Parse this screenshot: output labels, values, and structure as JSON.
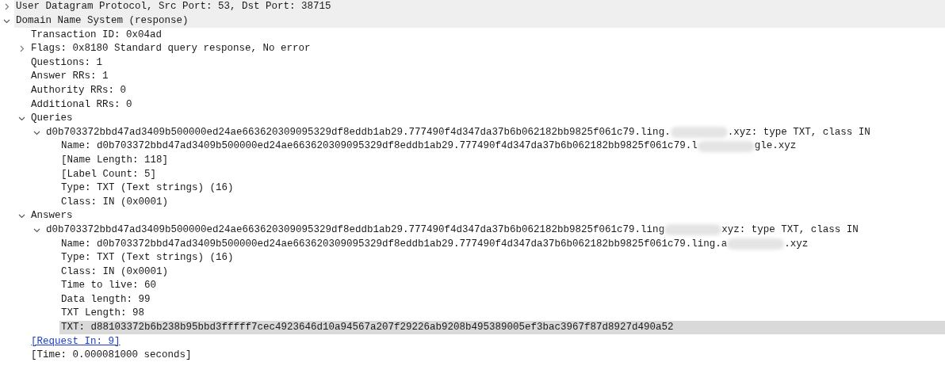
{
  "tree": [
    {
      "segments": [
        {
          "kind": "text",
          "text": "User Datagram Protocol, Src Port: 53, Dst Port: 38715"
        }
      ],
      "expanded": false,
      "highlighted": true,
      "selected": false
    },
    {
      "segments": [
        {
          "kind": "text",
          "text": "Domain Name System (response)"
        }
      ],
      "expanded": true,
      "highlighted": true,
      "selected": false,
      "children": [
        {
          "segments": [
            {
              "kind": "text",
              "text": "Transaction ID: 0x04ad"
            }
          ],
          "highlighted": false,
          "selected": false
        },
        {
          "segments": [
            {
              "kind": "text",
              "text": "Flags: 0x8180 Standard query response, No error"
            }
          ],
          "expanded": false,
          "highlighted": false,
          "selected": false
        },
        {
          "segments": [
            {
              "kind": "text",
              "text": "Questions: 1"
            }
          ],
          "highlighted": false,
          "selected": false
        },
        {
          "segments": [
            {
              "kind": "text",
              "text": "Answer RRs: 1"
            }
          ],
          "highlighted": false,
          "selected": false
        },
        {
          "segments": [
            {
              "kind": "text",
              "text": "Authority RRs: 0"
            }
          ],
          "highlighted": false,
          "selected": false
        },
        {
          "segments": [
            {
              "kind": "text",
              "text": "Additional RRs: 0"
            }
          ],
          "highlighted": false,
          "selected": false
        },
        {
          "segments": [
            {
              "kind": "text",
              "text": "Queries"
            }
          ],
          "expanded": true,
          "highlighted": false,
          "selected": false,
          "children": [
            {
              "segments": [
                {
                  "kind": "text",
                  "text": "d0b703372bbd47ad3409b500000ed24ae663620309095329df8eddb1ab29.777490f4d347da37b6b062182bb9825f061c79.ling."
                },
                {
                  "kind": "redaction"
                },
                {
                  "kind": "text",
                  "text": ".xyz: type TXT, class IN"
                }
              ],
              "expanded": true,
              "highlighted": false,
              "selected": false,
              "children": [
                {
                  "segments": [
                    {
                      "kind": "text",
                      "text": "Name: d0b703372bbd47ad3409b500000ed24ae663620309095329df8eddb1ab29.777490f4d347da37b6b062182bb9825f061c79.l"
                    },
                    {
                      "kind": "redaction"
                    },
                    {
                      "kind": "text",
                      "text": "gle.xyz"
                    }
                  ],
                  "highlighted": false,
                  "selected": false
                },
                {
                  "segments": [
                    {
                      "kind": "text",
                      "text": "[Name Length: 118]"
                    }
                  ],
                  "highlighted": false,
                  "selected": false
                },
                {
                  "segments": [
                    {
                      "kind": "text",
                      "text": "[Label Count: 5]"
                    }
                  ],
                  "highlighted": false,
                  "selected": false
                },
                {
                  "segments": [
                    {
                      "kind": "text",
                      "text": "Type: TXT (Text strings) (16)"
                    }
                  ],
                  "highlighted": false,
                  "selected": false
                },
                {
                  "segments": [
                    {
                      "kind": "text",
                      "text": "Class: IN (0x0001)"
                    }
                  ],
                  "highlighted": false,
                  "selected": false
                }
              ]
            }
          ]
        },
        {
          "segments": [
            {
              "kind": "text",
              "text": "Answers"
            }
          ],
          "expanded": true,
          "highlighted": false,
          "selected": false,
          "children": [
            {
              "segments": [
                {
                  "kind": "text",
                  "text": "d0b703372bbd47ad3409b500000ed24ae663620309095329df8eddb1ab29.777490f4d347da37b6b062182bb9825f061c79.ling"
                },
                {
                  "kind": "redaction"
                },
                {
                  "kind": "text",
                  "text": "xyz: type TXT, class IN"
                }
              ],
              "expanded": true,
              "highlighted": false,
              "selected": false,
              "children": [
                {
                  "segments": [
                    {
                      "kind": "text",
                      "text": "Name: d0b703372bbd47ad3409b500000ed24ae663620309095329df8eddb1ab29.777490f4d347da37b6b062182bb9825f061c79.ling.a"
                    },
                    {
                      "kind": "redaction"
                    },
                    {
                      "kind": "text",
                      "text": ".xyz"
                    }
                  ],
                  "highlighted": false,
                  "selected": false
                },
                {
                  "segments": [
                    {
                      "kind": "text",
                      "text": "Type: TXT (Text strings) (16)"
                    }
                  ],
                  "highlighted": false,
                  "selected": false
                },
                {
                  "segments": [
                    {
                      "kind": "text",
                      "text": "Class: IN (0x0001)"
                    }
                  ],
                  "highlighted": false,
                  "selected": false
                },
                {
                  "segments": [
                    {
                      "kind": "text",
                      "text": "Time to live: 60"
                    }
                  ],
                  "highlighted": false,
                  "selected": false
                },
                {
                  "segments": [
                    {
                      "kind": "text",
                      "text": "Data length: 99"
                    }
                  ],
                  "highlighted": false,
                  "selected": false
                },
                {
                  "segments": [
                    {
                      "kind": "text",
                      "text": "TXT Length: 98"
                    }
                  ],
                  "highlighted": false,
                  "selected": false
                },
                {
                  "segments": [
                    {
                      "kind": "text",
                      "text": "TXT: d88103372b6b238b95bbd3fffff7cec4923646d10a94567a207f29226ab9208b495389005ef3bac3967f87d8927d490a52"
                    }
                  ],
                  "selected": true
                }
              ]
            }
          ]
        },
        {
          "segments": [
            {
              "kind": "link",
              "text": "[Request In: 9]"
            }
          ],
          "highlighted": false,
          "selected": false
        },
        {
          "segments": [
            {
              "kind": "text",
              "text": "[Time: 0.000081000 seconds]"
            }
          ],
          "highlighted": false,
          "selected": false
        }
      ]
    }
  ]
}
